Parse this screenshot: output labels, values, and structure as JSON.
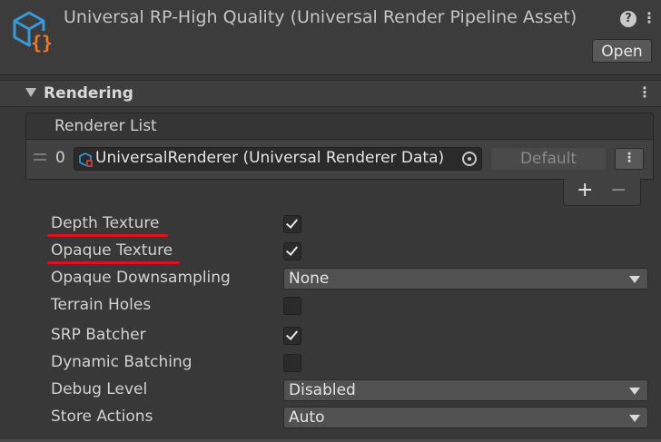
{
  "header": {
    "title": "Universal RP-High Quality (Universal Render Pipeline Asset)",
    "help_glyph": "?",
    "menu_glyph": "⋮",
    "open_label": "Open",
    "icon": "urp-asset-icon",
    "icon_brace": "{}"
  },
  "section": {
    "title": "Rendering",
    "menu_glyph": "⋮"
  },
  "renderer_list": {
    "title": "Renderer List",
    "rows": [
      {
        "index": "0",
        "value": "UniversalRenderer (Universal Renderer Data)",
        "default_label": "Default",
        "menu_glyph": "⋮"
      }
    ],
    "add_glyph": "+",
    "remove_glyph": "−"
  },
  "properties": [
    {
      "label": "Depth Texture",
      "type": "toggle",
      "checked": true,
      "highlighted": true
    },
    {
      "label": "Opaque Texture",
      "type": "toggle",
      "checked": true,
      "highlighted": true
    },
    {
      "label": "Opaque Downsampling",
      "type": "dropdown",
      "value": "None"
    },
    {
      "label": "Terrain Holes",
      "type": "toggle",
      "checked": false
    },
    {
      "label": "SRP Batcher",
      "type": "toggle",
      "checked": true
    },
    {
      "label": "Dynamic Batching",
      "type": "toggle",
      "checked": false
    },
    {
      "label": "Debug Level",
      "type": "dropdown",
      "value": "Disabled"
    },
    {
      "label": "Store Actions",
      "type": "dropdown",
      "value": "Auto"
    }
  ],
  "colors": {
    "background": "#383838",
    "highlight_underline": "#e0101c",
    "icon_blue": "#3a9ad9",
    "icon_orange": "#f07828"
  }
}
